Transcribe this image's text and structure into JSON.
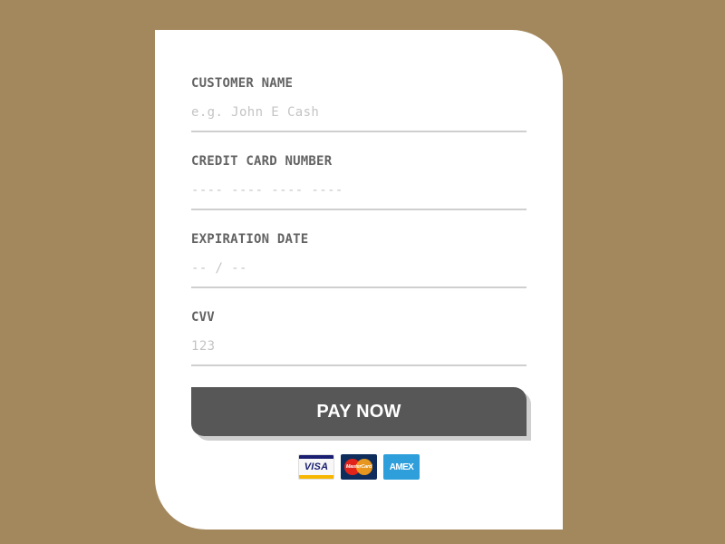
{
  "form": {
    "fields": [
      {
        "label": "CUSTOMER NAME",
        "placeholder": "e.g. John E Cash",
        "value": ""
      },
      {
        "label": "CREDIT CARD NUMBER",
        "placeholder": "---- ---- ---- ----",
        "value": ""
      },
      {
        "label": "EXPIRATION DATE",
        "placeholder": "-- / --",
        "value": ""
      },
      {
        "label": "CVV",
        "placeholder": "123",
        "value": ""
      }
    ],
    "submit_label": "PAY NOW"
  },
  "payment_methods": [
    {
      "name": "VISA",
      "icon": "visa-icon"
    },
    {
      "name": "MasterCard",
      "icon": "mastercard-icon"
    },
    {
      "name": "AMEX",
      "icon": "amex-icon"
    }
  ],
  "colors": {
    "background": "#a4885d",
    "card": "#ffffff",
    "button": "#575757",
    "button_shadow": "#cfcfcf",
    "label": "#636363",
    "placeholder": "#c4c4c4",
    "underline": "#cfcfcf"
  }
}
